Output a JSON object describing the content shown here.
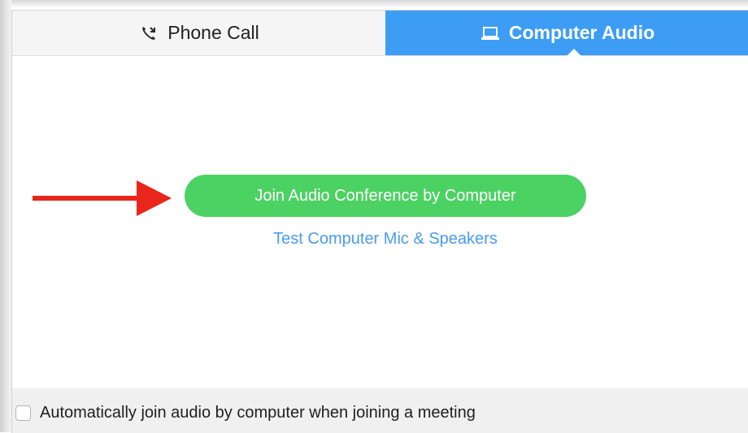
{
  "tabs": {
    "phone": {
      "label": "Phone Call",
      "icon": "phone-icon"
    },
    "computer": {
      "label": "Computer Audio",
      "icon": "laptop-icon"
    }
  },
  "main": {
    "join_button_label": "Join Audio Conference by Computer",
    "test_link_label": "Test Computer Mic & Speakers"
  },
  "footer": {
    "auto_join_label": "Automatically join audio by computer when joining a meeting",
    "auto_join_checked": false
  },
  "annotation": {
    "arrow_icon": "red-arrow-icon"
  },
  "colors": {
    "active_tab": "#3d9df5",
    "join_button": "#4cd163",
    "link": "#4a9bf0",
    "arrow": "#e8261c"
  }
}
